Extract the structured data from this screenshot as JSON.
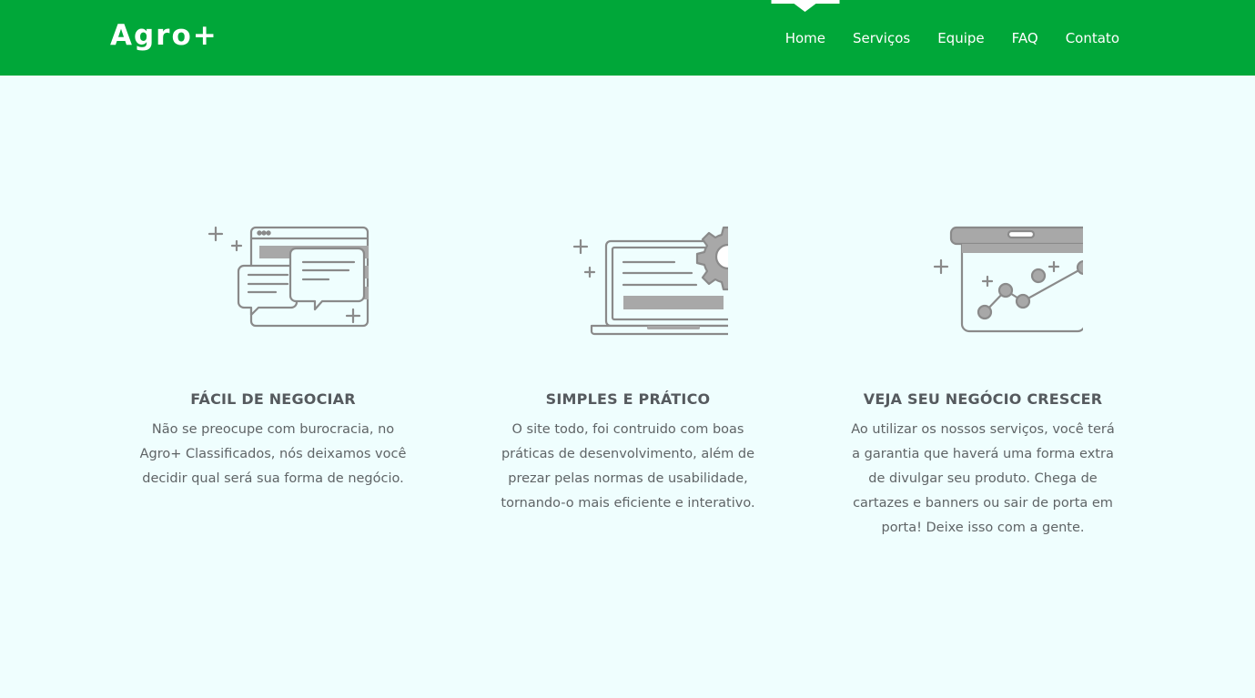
{
  "navbar": {
    "brand": "Agro+",
    "background": "#00a739",
    "links": [
      {
        "label": "Home",
        "active": true
      },
      {
        "label": "Serviços",
        "active": false
      },
      {
        "label": "Equipe",
        "active": false
      },
      {
        "label": "FAQ",
        "active": false
      },
      {
        "label": "Contato",
        "active": false
      }
    ]
  },
  "features": [
    {
      "icon": "chat-window-icon",
      "title": "FÁCIL DE NEGOCIAR",
      "text": "Não se preocupe com burocracia, no Agro+ Classificados, nós deixamos você decidir qual será sua forma de negócio."
    },
    {
      "icon": "laptop-gear-icon",
      "title": "SIMPLES E PRÁTICO",
      "text": "O site todo, foi contruido com boas práticas de desenvolvimento, além de prezar pelas normas de usabilidade, tornando-o mais eficiente e interativo."
    },
    {
      "icon": "growth-chart-board-icon",
      "title": "VEJA SEU NEGÓCIO CRESCER",
      "text": "Ao utilizar os nossos serviços, você terá a garantia que haverá uma forma extra de divulgar seu produto. Chega de cartazes e banners ou sair de porta em porta! Deixe isso com a gente."
    }
  ],
  "colors": {
    "page_background": "#effefe",
    "icon_stroke": "#8a8a8a",
    "icon_fill": "#a8a8a8",
    "heading": "#555a5e"
  }
}
